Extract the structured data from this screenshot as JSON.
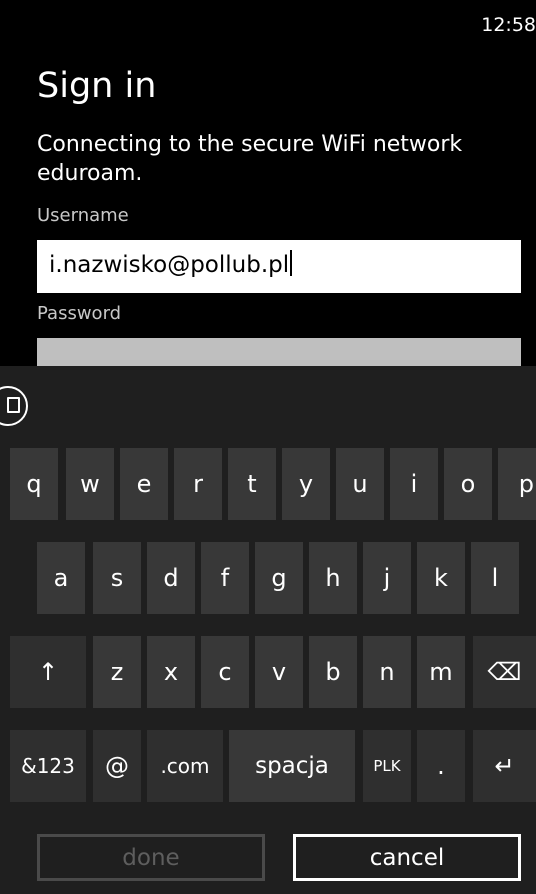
{
  "status": {
    "time": "12:58"
  },
  "page": {
    "title": "Sign in",
    "description": "Connecting to the secure WiFi network eduroam.",
    "username_label": "Username",
    "username_value": "i.nazwisko@pollub.pl",
    "password_label": "Password"
  },
  "keyboard": {
    "row1": [
      "q",
      "w",
      "e",
      "r",
      "t",
      "y",
      "u",
      "i",
      "o",
      "p"
    ],
    "row2": [
      "a",
      "s",
      "d",
      "f",
      "g",
      "h",
      "j",
      "k",
      "l"
    ],
    "row3": [
      "↑",
      "z",
      "x",
      "c",
      "v",
      "b",
      "n",
      "m",
      "⌫"
    ],
    "row4": [
      "&123",
      "@",
      ".com",
      "spacja",
      "PLK",
      ".",
      "↵"
    ]
  },
  "buttons": {
    "done": "done",
    "cancel": "cancel"
  },
  "colors": {
    "background": "#000000",
    "key": "#383838",
    "keyboard_bg": "#1f1f1f"
  }
}
